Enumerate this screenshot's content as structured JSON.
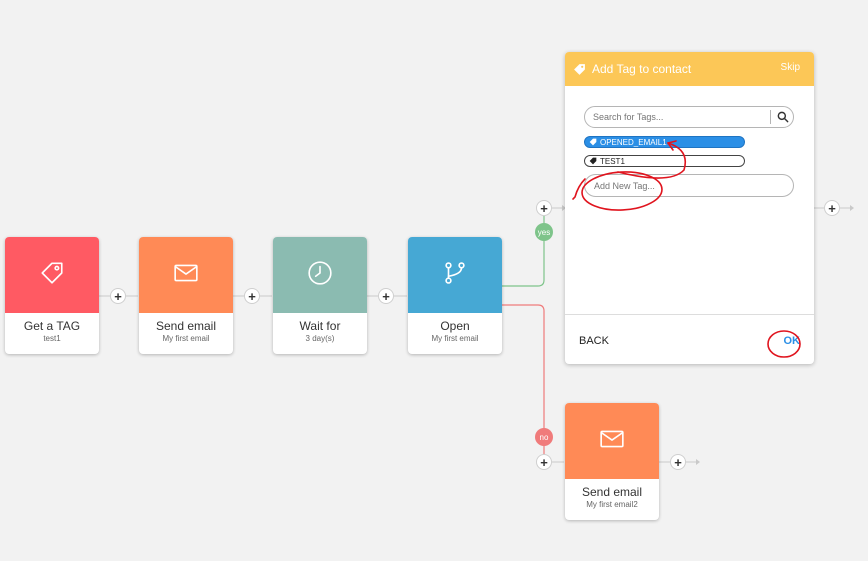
{
  "nodes": [
    {
      "title": "Get a TAG",
      "subtitle": "test1",
      "color": "#ff5a63",
      "icon": "tag-icon"
    },
    {
      "title": "Send email",
      "subtitle": "My first email",
      "color": "#ff8a56",
      "icon": "envelope-icon"
    },
    {
      "title": "Wait for",
      "subtitle": "3 day(s)",
      "color": "#8bbbb1",
      "icon": "clock-icon"
    },
    {
      "title": "Open",
      "subtitle": "My first email",
      "color": "#46a8d4",
      "icon": "branch-icon"
    },
    {
      "title": "Send email",
      "subtitle": "My first email2",
      "color": "#ff8a56",
      "icon": "envelope-icon"
    }
  ],
  "branches": {
    "yes_label": "yes",
    "no_label": "no",
    "yes_color": "#7ec48a",
    "no_color": "#f07b7b"
  },
  "add_button_label": "+",
  "panel": {
    "title": "Add Tag to contact",
    "skip_label": "Skip",
    "header_color": "#fcc757",
    "search_placeholder": "Search for Tags...",
    "tags": [
      {
        "label": "OPENED_EMAIL1",
        "selected": true
      },
      {
        "label": "TEST1",
        "selected": false
      }
    ],
    "new_tag_placeholder": "Add New Tag...",
    "back_label": "BACK",
    "ok_label": "OK"
  }
}
